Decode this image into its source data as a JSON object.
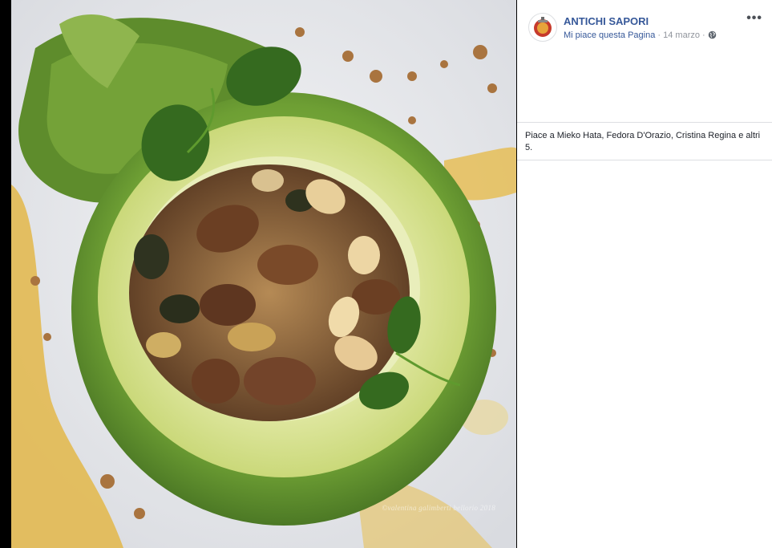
{
  "post": {
    "page_name": "ANTICHI SAPORI",
    "like_page": "Mi piace questa Pagina",
    "separator": " · ",
    "date": "14 marzo",
    "more_label": "•••",
    "likes_text": "Piace a Mieko Hata, Fedora D'Orazio, Cristina Regina e altri 5."
  },
  "photo": {
    "watermark": "©valentina galimberti bellorio 2018"
  },
  "icons": {
    "avatar": "page-logo-icon",
    "audience": "globe-icon",
    "menu": "more-options-icon"
  },
  "colors": {
    "link": "#365899",
    "meta": "#90949c",
    "divider": "#dddfe2"
  }
}
